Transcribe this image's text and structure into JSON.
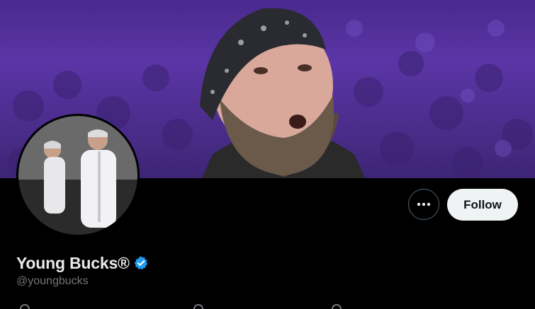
{
  "profile": {
    "display_name": "Young Bucks®",
    "handle": "@youngbucks",
    "verified": true,
    "verified_color": "#1d9bf0"
  },
  "actions": {
    "more_icon": "ellipsis-icon",
    "follow_label": "Follow"
  },
  "colors": {
    "background": "#000000",
    "banner_purple": "#5b35a6",
    "follow_bg": "#eff3f4",
    "name_text": "#e7e9ea",
    "handle_text": "#71767b"
  }
}
